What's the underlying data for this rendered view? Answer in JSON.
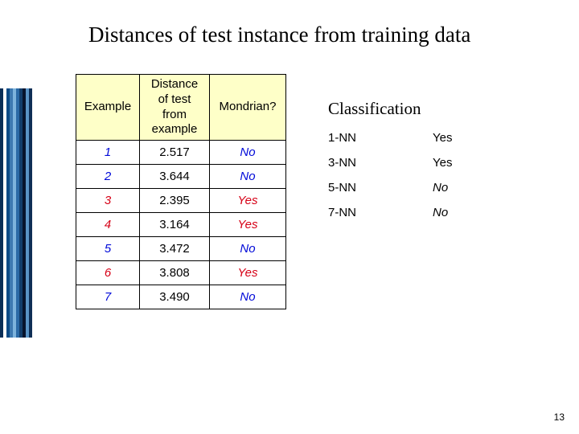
{
  "title": "Distances of test instance from training data",
  "page_number": "13",
  "dist_table": {
    "headers": [
      "Example",
      "Distance\nof test\nfrom\nexample",
      "Mondrian?"
    ],
    "rows": [
      {
        "example": "1",
        "distance": "2.517",
        "mondrian": "No",
        "color": "blue"
      },
      {
        "example": "2",
        "distance": "3.644",
        "mondrian": "No",
        "color": "blue"
      },
      {
        "example": "3",
        "distance": "2.395",
        "mondrian": "Yes",
        "color": "red"
      },
      {
        "example": "4",
        "distance": "3.164",
        "mondrian": "Yes",
        "color": "red"
      },
      {
        "example": "5",
        "distance": "3.472",
        "mondrian": "No",
        "color": "blue"
      },
      {
        "example": "6",
        "distance": "3.808",
        "mondrian": "Yes",
        "color": "red"
      },
      {
        "example": "7",
        "distance": "3.490",
        "mondrian": "No",
        "color": "blue"
      }
    ]
  },
  "classification": {
    "heading": "Classification",
    "rows": [
      {
        "k": "1-NN",
        "answer": "Yes"
      },
      {
        "k": "3-NN",
        "answer": "Yes"
      },
      {
        "k": "5-NN",
        "answer": "No"
      },
      {
        "k": "7-NN",
        "answer": "No"
      }
    ]
  },
  "stripes": [
    "#0a2e57",
    "#ffffff",
    "#0b4a86",
    "#3d79b1",
    "#7db3dc",
    "#2b6aa6",
    "#123e6b",
    "#08142d",
    "#5a94c6",
    "#0f2e55"
  ]
}
